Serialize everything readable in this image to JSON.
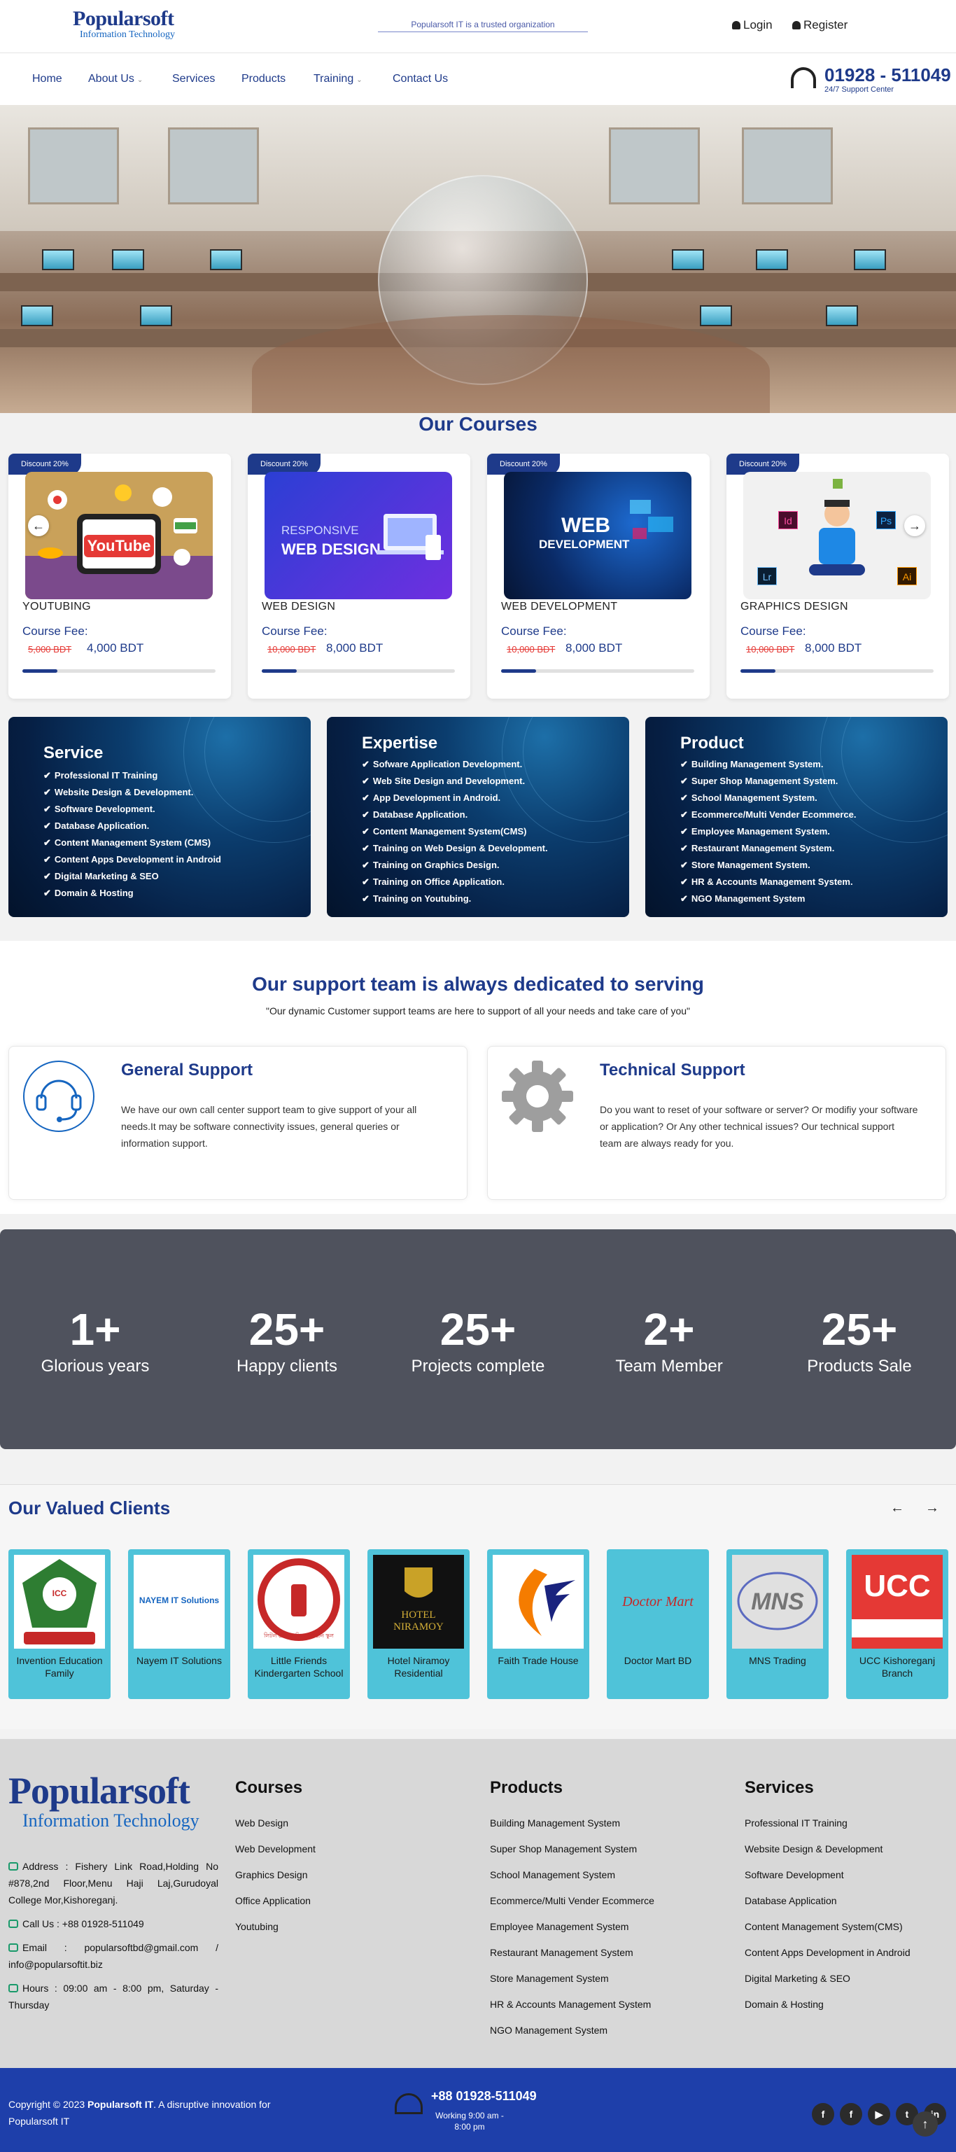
{
  "header": {
    "logo_main": "Popularsoft",
    "logo_sub": "Information Technology",
    "marquee": "Popularsoft IT is a trusted organization",
    "login": "Login",
    "register": "Register"
  },
  "nav": {
    "items": [
      "Home",
      "About Us",
      "Services",
      "Products",
      "Training",
      "Contact Us"
    ],
    "phone": "01928 - 511049",
    "phone_sub": "24/7 Support Center"
  },
  "courses": {
    "title": "Our Courses",
    "fee_label": "Course Fee:",
    "items": [
      {
        "badge": "Discount 20%",
        "name": "YOUTUBING",
        "old": "5,000 BDT",
        "new": "4,000 BDT",
        "progress": 0.18,
        "thumb_text": "YouTube"
      },
      {
        "badge": "Discount 20%",
        "name": "WEB DESIGN",
        "old": "10,000 BDT",
        "new": "8,000 BDT",
        "progress": 0.18,
        "thumb_text_1": "RESPONSIVE",
        "thumb_text_2": "WEB DESIGN"
      },
      {
        "badge": "Discount 20%",
        "name": "WEB DEVELOPMENT",
        "old": "10,000 BDT",
        "new": "8,000 BDT",
        "progress": 0.18,
        "thumb_text_1": "WEB",
        "thumb_text_2": "DEVELOPMENT"
      },
      {
        "badge": "Discount 20%",
        "name": "GRAPHICS DESIGN",
        "old": "10,000 BDT",
        "new": "8,000 BDT",
        "progress": 0.18,
        "thumb_badges": [
          "Id",
          "Ps",
          "Lr",
          "Ai"
        ]
      }
    ]
  },
  "panels": [
    {
      "title": "Service",
      "items": [
        "Professional IT Training",
        "Website Design & Development.",
        "Software Development.",
        "Database Application.",
        "Content Management System (CMS)",
        "Content Apps Development in Android",
        "Digital Marketing & SEO",
        "Domain & Hosting"
      ]
    },
    {
      "title": "Expertise",
      "items": [
        "Sofware Application Development.",
        "Web Site Design and Development.",
        "App Development in Android.",
        "Database Application.",
        "Content Management System(CMS)",
        "Training on Web Design & Development.",
        "Training on Graphics Design.",
        "Training on Office Application.",
        "Training on Youtubing."
      ]
    },
    {
      "title": "Product",
      "items": [
        "Building Management System.",
        "Super Shop Management System.",
        "School Management System.",
        "Ecommerce/Multi Vender Ecommerce.",
        "Employee Management System.",
        "Restaurant Management System.",
        "Store Management System.",
        "HR & Accounts Management System.",
        "NGO Management System"
      ]
    }
  ],
  "support": {
    "title": "Our support team is always dedicated to serving",
    "subtitle": "\"Our dynamic Customer support teams are here to support of all your needs and take care of you\"",
    "general": {
      "title": "General Support",
      "text": "We have our own call center support team to give support of your all needs.It may be software connectivity issues, general queries or information support."
    },
    "technical": {
      "title": "Technical Support",
      "text": "Do you want to reset of your software or server? Or modifiy your software or application? Or Any other technical issues? Our technical support team are always ready for you."
    }
  },
  "stats": [
    {
      "num": "1+",
      "label": "Glorious years"
    },
    {
      "num": "25+",
      "label": "Happy clients"
    },
    {
      "num": "25+",
      "label": "Projects complete"
    },
    {
      "num": "2+",
      "label": "Team Member"
    },
    {
      "num": "25+",
      "label": "Products Sale"
    }
  ],
  "clients": {
    "title": "Our Valued Clients",
    "items": [
      {
        "name": "Invention Education Family",
        "logo": "ICC"
      },
      {
        "name": "Nayem IT Solutions",
        "logo": "NAYEM IT Solutions"
      },
      {
        "name": "Little Friends Kindergarten School",
        "logo": "লিটল ফ্রেন্ডস কিন্ডারগার্টেন স্কুল"
      },
      {
        "name": "Hotel Niramoy Residential",
        "logo": "HOTEL NIRAMOY"
      },
      {
        "name": "Faith Trade House",
        "logo": ""
      },
      {
        "name": "Doctor Mart BD",
        "logo": "Doctor Mart"
      },
      {
        "name": "MNS Trading",
        "logo": "MNS"
      },
      {
        "name": "UCC Kishoreganj Branch",
        "logo": "UCC"
      }
    ]
  },
  "footer": {
    "logo_main": "Popularsoft",
    "logo_sub": "Information Technology",
    "address": "Address : Fishery Link Road,Holding No #878,2nd Floor,Menu Haji Laj,Gurudoyal College Mor,Kishoreganj.",
    "call": "Call Us : +88 01928-511049",
    "email": "Email : popularsoftbd@gmail.com / info@popularsoftit.biz",
    "hours": "Hours : 09:00 am - 8:00 pm, Saturday - Thursday",
    "courses": {
      "title": "Courses",
      "items": [
        "Web Design",
        "Web Development",
        "Graphics Design",
        "Office Application",
        "Youtubing"
      ]
    },
    "products": {
      "title": "Products",
      "items": [
        "Building Management System",
        "Super Shop Management System",
        "School Management System",
        "Ecommerce/Multi Vender Ecommerce",
        "Employee Management System",
        "Restaurant Management System",
        "Store Management System",
        "HR & Accounts Management System",
        "NGO Management System"
      ]
    },
    "services": {
      "title": "Services",
      "items": [
        "Professional IT Training",
        "Website Design & Development",
        "Software Development",
        "Database Application",
        "Content Management System(CMS)",
        "Content Apps Development in Android",
        "Digital Marketing & SEO",
        "Domain & Hosting"
      ]
    }
  },
  "bottom": {
    "copyright_pre": "Copyright © 2023",
    "copyright_brand": "Popularsoft IT",
    "copyright_post": ". A disruptive innovation for Popularsoft IT",
    "phone": "+88 01928-511049",
    "hours": "Working 9:00 am - 8:00 pm",
    "social": [
      "f",
      "f",
      "▶",
      "t",
      "in"
    ],
    "to_top": "↑"
  },
  "colors": {
    "brand": "#1e3a8a",
    "accent": "#1565c0",
    "client_tile": "#4fc3d9",
    "stats_bg": "#4f525d",
    "bottom_bar": "#1e3faa"
  }
}
